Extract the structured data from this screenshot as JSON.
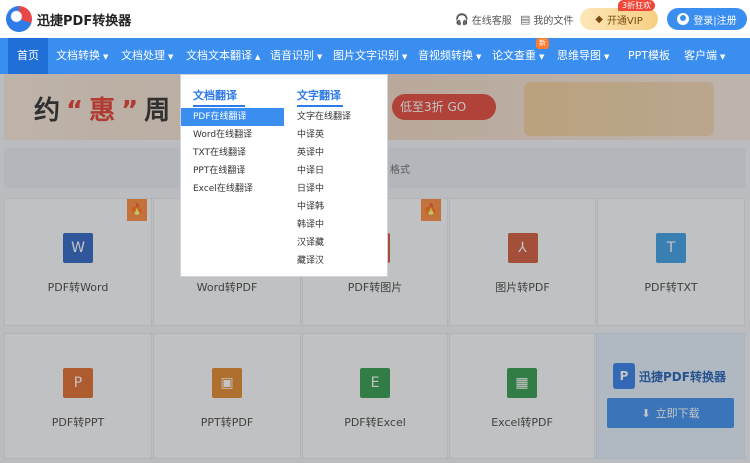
{
  "header": {
    "brand": "迅捷PDF转换器",
    "service": "在线客服",
    "my_files": "我的文件",
    "vip_badge": "3折狂欢",
    "vip_label": "开通VIP",
    "login_label": "登录|注册"
  },
  "nav": {
    "items": [
      {
        "label": "首页"
      },
      {
        "label": "文档转换"
      },
      {
        "label": "文档处理"
      },
      {
        "label": "文档文本翻译"
      },
      {
        "label": "语音识别"
      },
      {
        "label": "图片文字识别"
      },
      {
        "label": "音视频转换"
      },
      {
        "label": "论文查重"
      },
      {
        "label": "思维导图"
      },
      {
        "label": "PPT模板"
      },
      {
        "label": "客户端"
      }
    ],
    "new_badge": "新"
  },
  "banner": {
    "text_1": "约",
    "text_highlight": "“惠”",
    "text_2": "周",
    "pill": "低至3折 GO"
  },
  "filter_hint": "格式",
  "dropdown": {
    "doc_heading": "文档翻译",
    "doc_items": [
      "PDF在线翻译",
      "Word在线翻译",
      "TXT在线翻译",
      "PPT在线翻译",
      "Excel在线翻译"
    ],
    "text_heading": "文字翻译",
    "text_items": [
      "文字在线翻译",
      "中译英",
      "英译中",
      "中译日",
      "日译中",
      "中译韩",
      "韩译中",
      "汉译藏",
      "藏译汉"
    ]
  },
  "tools_row1": [
    {
      "label": "PDF转Word",
      "icon": "W",
      "color": "#2b62c4"
    },
    {
      "label": "Word转PDF",
      "icon": "",
      "color": "#2b62c4"
    },
    {
      "label": "PDF转图片",
      "icon": "",
      "color": "#d2583a"
    },
    {
      "label": "图片转PDF",
      "icon": "⅄",
      "color": "#d2583a"
    },
    {
      "label": "PDF转TXT",
      "icon": "T",
      "color": "#3a9de6"
    }
  ],
  "tools_row2": [
    {
      "label": "PDF转PPT",
      "icon": "P",
      "color": "#e06a2a"
    },
    {
      "label": "PPT转PDF",
      "icon": "▣",
      "color": "#e0862a"
    },
    {
      "label": "PDF转Excel",
      "icon": "E",
      "color": "#2e9a4a"
    },
    {
      "label": "Excel转PDF",
      "icon": "▦",
      "color": "#2e9a4a"
    }
  ],
  "download": {
    "title": "迅捷PDF转换器",
    "logo": "P",
    "button": "立即下载"
  },
  "hot_icon": "🔥"
}
